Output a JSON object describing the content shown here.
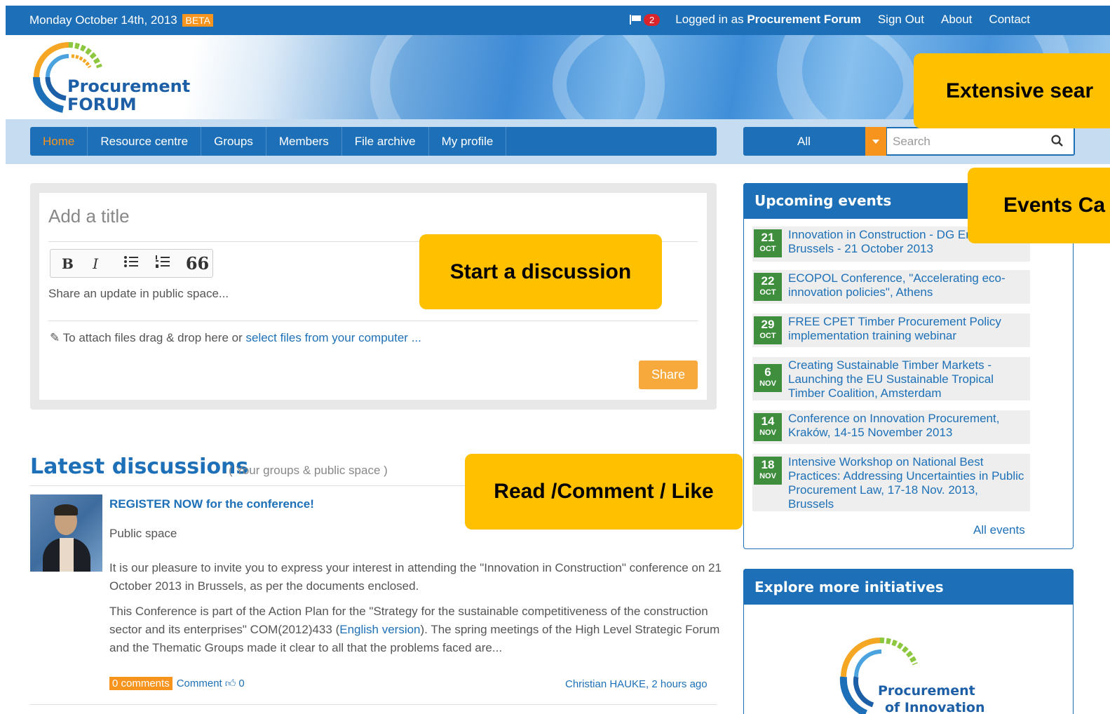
{
  "topbar": {
    "date": "Monday October 14th, 2013",
    "beta": "BETA",
    "notification_count": "2",
    "logged_in_prefix": "Logged in as",
    "user": "Procurement Forum",
    "links": [
      "Sign Out",
      "About",
      "Contact"
    ]
  },
  "logo": {
    "line1": "Procurement",
    "line2": "FORUM"
  },
  "nav": {
    "items": [
      "Home",
      "Resource centre",
      "Groups",
      "Members",
      "File archive",
      "My profile"
    ],
    "active": "Home"
  },
  "search": {
    "scope": "All",
    "placeholder": "Search"
  },
  "composer": {
    "title_placeholder": "Add a title",
    "toolbar": {
      "bold": "B",
      "italic": "I",
      "quote": "66"
    },
    "body_placeholder": "Share an update in public space...",
    "attach_text": "To attach files drag & drop here or",
    "attach_link": "select files from your computer ...",
    "share_label": "Share"
  },
  "discussions": {
    "heading": "Latest discussions",
    "subheading": "( Your groups & public space )",
    "post": {
      "title": "REGISTER NOW for the conference!",
      "space": "Public space",
      "para1": "It is our pleasure to invite you to express your interest in attending the \"Innovation in Construction\" conference on 21 October 2013 in Brussels, as per the documents enclosed.",
      "para2_a": "This Conference is part of the Action Plan for the \"Strategy for the sustainable competitiveness of the construction sector and its enterprises\" COM(2012)433 (",
      "para2_link": "English version",
      "para2_b": "). The spring meetings of the High Level Strategic Forum and the Thematic Groups made it clear to all that the problems faced are...",
      "comments_badge": "0 comments",
      "comment_label": "Comment",
      "likes": "0",
      "author": "Christian HAUKE",
      "time": ", 2 hours ago"
    }
  },
  "events": {
    "heading": "Upcoming events",
    "items": [
      {
        "day": "21",
        "month": "OCT",
        "title": "Innovation in Construction - DG Enterprise - Brussels - 21 October 2013"
      },
      {
        "day": "22",
        "month": "OCT",
        "title": "ECOPOL Conference, \"Accelerating eco-innovation policies\", Athens"
      },
      {
        "day": "29",
        "month": "OCT",
        "title": "FREE CPET Timber Procurement Policy implementation training webinar"
      },
      {
        "day": "6",
        "month": "NOV",
        "title": "Creating Sustainable Timber Markets - Launching the EU Sustainable Tropical Timber Coalition, Amsterdam"
      },
      {
        "day": "14",
        "month": "NOV",
        "title": "Conference on Innovation Procurement, Kraków, 14-15 November 2013"
      },
      {
        "day": "18",
        "month": "NOV",
        "title": "Intensive Workshop on National Best Practices: Addressing Uncertainties in Public Procurement Law, 17-18 Nov. 2013, Brussels"
      }
    ],
    "all_link": "All events"
  },
  "explore": {
    "heading": "Explore more initiatives",
    "logo_line1": "Procurement",
    "logo_line2": "of Innovation"
  },
  "callouts": {
    "search": "Extensive sear",
    "events": "Events Ca",
    "discussion": "Start a discussion",
    "read": "Read /Comment / Like"
  },
  "colors": {
    "primary_blue": "#1d70b7",
    "accent_orange": "#f7941d",
    "callout_yellow": "#ffc000",
    "event_green": "#3e8e3e"
  }
}
